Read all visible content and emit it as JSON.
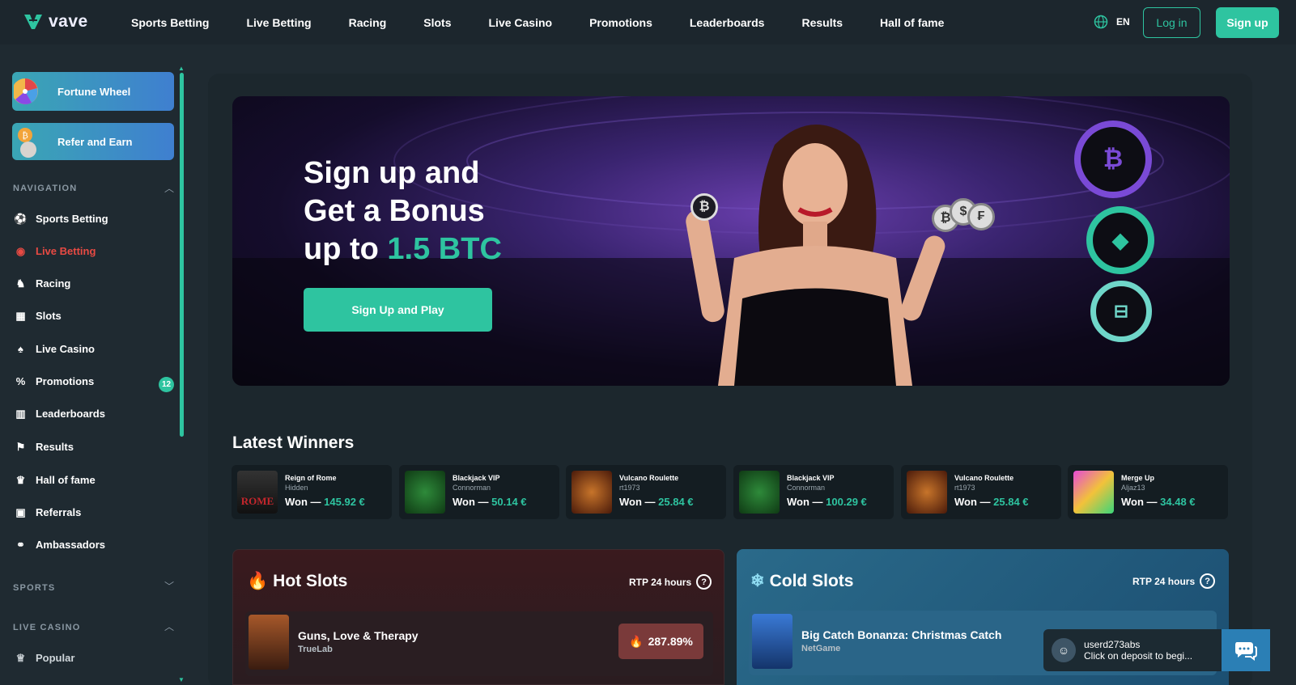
{
  "brand": {
    "name": "vave"
  },
  "topnav": {
    "items": [
      "Sports Betting",
      "Live Betting",
      "Racing",
      "Slots",
      "Live Casino",
      "Promotions",
      "Leaderboards",
      "Results",
      "Hall of fame"
    ],
    "lang": "EN",
    "login": "Log in",
    "signup": "Sign up"
  },
  "sidebar": {
    "promos": [
      {
        "label": "Fortune Wheel",
        "icon": "fortune-wheel-icon"
      },
      {
        "label": "Refer and Earn",
        "icon": "refer-earn-icon"
      }
    ],
    "navigation_title": "NAVIGATION",
    "nav": [
      {
        "label": "Sports Betting",
        "icon": "soccer-ball-icon"
      },
      {
        "label": "Live Betting",
        "icon": "live-signal-icon",
        "active": true
      },
      {
        "label": "Racing",
        "icon": "horse-icon"
      },
      {
        "label": "Slots",
        "icon": "slot-machine-icon"
      },
      {
        "label": "Live Casino",
        "icon": "cards-icon"
      },
      {
        "label": "Promotions",
        "icon": "promotions-icon",
        "badge": "12"
      },
      {
        "label": "Leaderboards",
        "icon": "leaderboard-icon"
      },
      {
        "label": "Results",
        "icon": "flag-icon"
      },
      {
        "label": "Hall of fame",
        "icon": "hall-of-fame-icon"
      },
      {
        "label": "Referrals",
        "icon": "referrals-icon"
      },
      {
        "label": "Ambassadors",
        "icon": "handshake-icon"
      }
    ],
    "sports_title": "SPORTS",
    "live_casino_title": "LIVE CASINO",
    "live_casino_items": [
      {
        "label": "Popular",
        "icon": "crown-icon"
      }
    ]
  },
  "hero": {
    "line1": "Sign up and",
    "line2": "Get a Bonus",
    "line3_prefix": "up to ",
    "line3_accent": "1.5 BTC",
    "button": "Sign Up and Play"
  },
  "latest_winners": {
    "title": "Latest Winners",
    "items": [
      {
        "game": "Reign of Rome",
        "user": "Hidden",
        "won_label": "Won —",
        "amount": "145.92 €"
      },
      {
        "game": "Blackjack VIP",
        "user": "Connorman",
        "won_label": "Won —",
        "amount": "50.14 €"
      },
      {
        "game": "Vulcano Roulette",
        "user": "rt1973",
        "won_label": "Won —",
        "amount": "25.84 €"
      },
      {
        "game": "Blackjack VIP",
        "user": "Connorman",
        "won_label": "Won —",
        "amount": "100.29 €"
      },
      {
        "game": "Vulcano Roulette",
        "user": "rt1973",
        "won_label": "Won —",
        "amount": "25.84 €"
      },
      {
        "game": "Merge Up",
        "user": "Aljaz13",
        "won_label": "Won —",
        "amount": "34.48 €"
      }
    ]
  },
  "hot_slots": {
    "title": "Hot Slots",
    "rtp": "RTP 24 hours",
    "rows": [
      {
        "name": "Guns, Love & Therapy",
        "provider": "TrueLab",
        "value": "287.89%"
      }
    ]
  },
  "cold_slots": {
    "title": "Cold Slots",
    "rtp": "RTP 24 hours",
    "rows": [
      {
        "name": "Big Catch Bonanza: Christmas Catch",
        "provider": "NetGame"
      }
    ]
  },
  "chat": {
    "user": "userd273abs",
    "message": "Click on deposit to begi..."
  },
  "colors": {
    "accent": "#2ec4a0",
    "live": "#e84a43",
    "background": "#1f2a31"
  }
}
